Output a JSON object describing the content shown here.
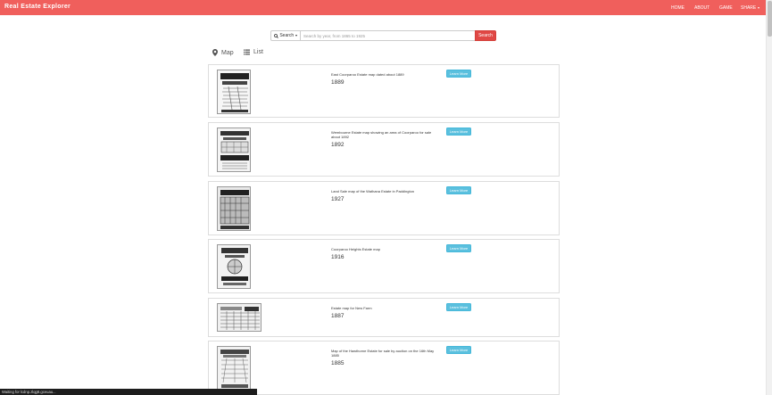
{
  "navbar": {
    "brand": "Real Estate Explorer",
    "links": [
      "HOME",
      "ABOUT",
      "GAME",
      "SHARE"
    ]
  },
  "search": {
    "dropdown_label": "Search",
    "placeholder": "Search by year, from 1865 to 1925",
    "button_label": "Search"
  },
  "views": {
    "map_label": "Map",
    "list_label": "List"
  },
  "listings": [
    {
      "description": "East Coorparoo Estate map dated about 1889",
      "year": "1889",
      "button": "Learn More"
    },
    {
      "description": "Wembourne Estate map showing an area of Coorparoo for sale about 1892",
      "year": "1892",
      "button": "Learn More"
    },
    {
      "description": "Land Sale map of the Wathana Estate in Paddington",
      "year": "1927",
      "button": "Learn More"
    },
    {
      "description": "Coorparoo Heights Estate map",
      "year": "1916",
      "button": "Learn More"
    },
    {
      "description": "Estate map for New Farm",
      "year": "1887",
      "button": "Learn More"
    },
    {
      "description": "Map of the Hawthorne Estate for sale by auction on the 16th May 1885",
      "year": "1885",
      "button": "Learn More"
    }
  ],
  "status_bar": "Waiting for lcdnp.zlqg8.gceuau..."
}
